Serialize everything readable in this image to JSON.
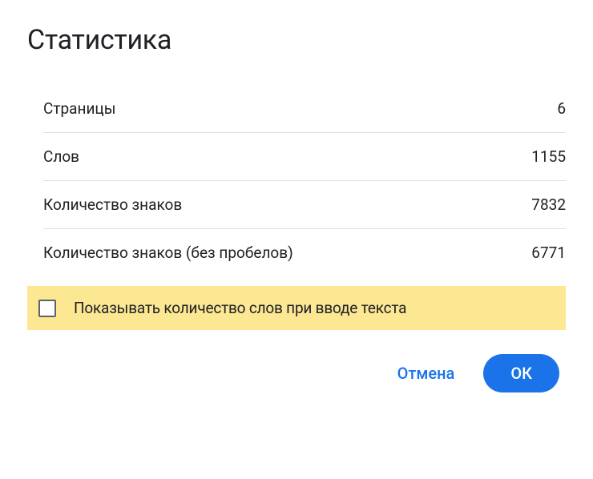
{
  "dialog": {
    "title": "Статистика"
  },
  "stats": {
    "rows": [
      {
        "label": "Страницы",
        "value": "6"
      },
      {
        "label": "Слов",
        "value": "1155"
      },
      {
        "label": "Количество знаков",
        "value": "7832"
      },
      {
        "label": "Количество знаков (без пробелов)",
        "value": "6771"
      }
    ]
  },
  "checkbox": {
    "label": "Показывать количество слов при вводе текста"
  },
  "buttons": {
    "cancel": "Отмена",
    "ok": "ОК"
  }
}
